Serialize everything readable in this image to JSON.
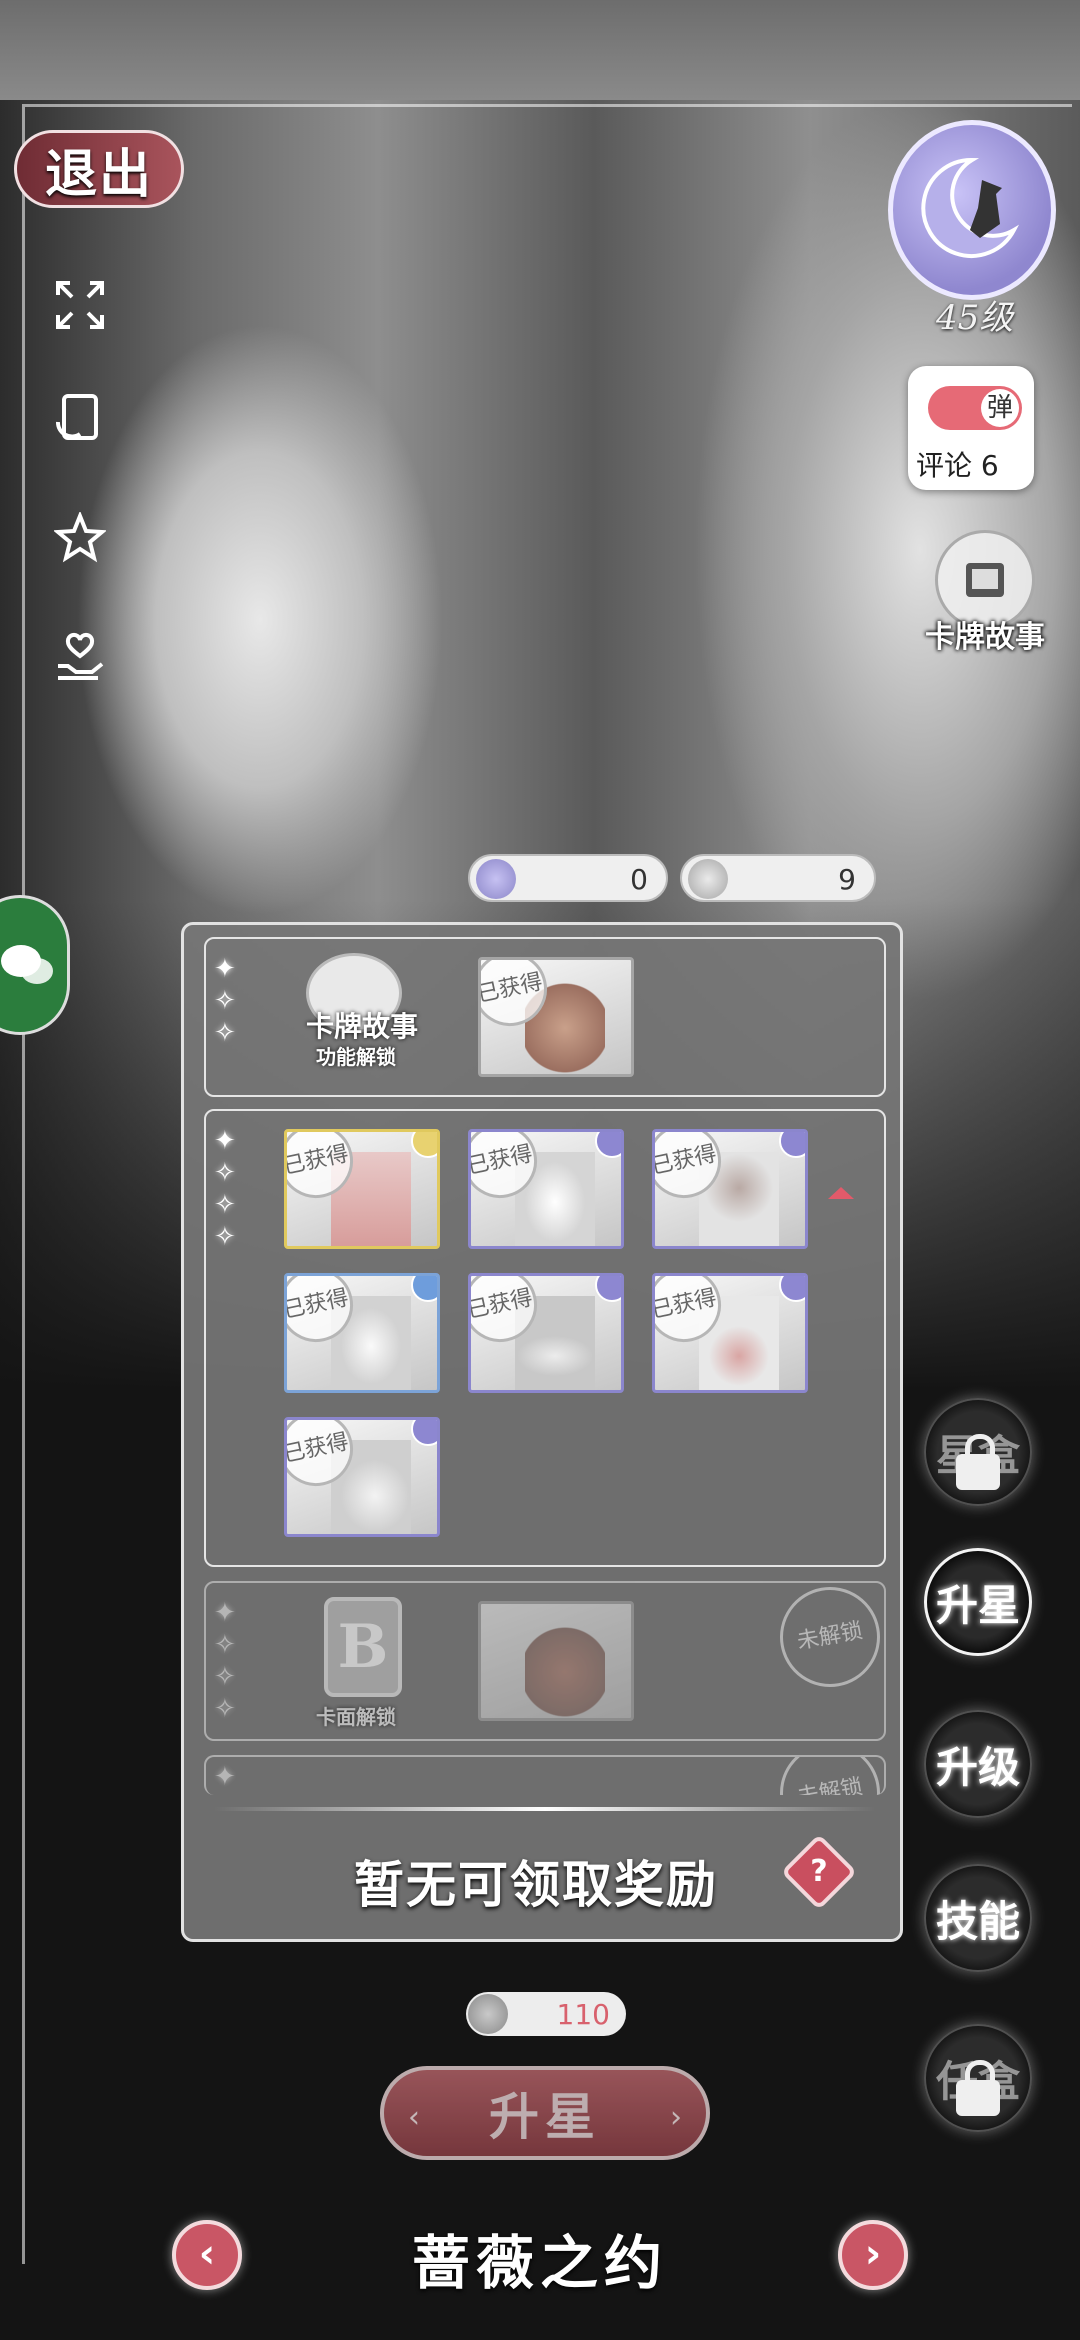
{
  "header": {
    "exit_label": "退出"
  },
  "left_tools": [
    {
      "name": "fullscreen-icon"
    },
    {
      "name": "rotate-card-icon"
    },
    {
      "name": "star-favorite-icon"
    },
    {
      "name": "heart-hand-icon"
    }
  ],
  "right_panel": {
    "level": "45级",
    "danmu_toggle": "弹",
    "comments": "评论 6",
    "card_story": "卡牌故事",
    "buttons": [
      {
        "label": "星盒",
        "locked": true
      },
      {
        "label": "升星",
        "active": true
      },
      {
        "label": "升级"
      },
      {
        "label": "技能"
      },
      {
        "label": "任盒",
        "locked": true
      }
    ]
  },
  "currencies": [
    {
      "icon": "potion-icon",
      "value": "0"
    },
    {
      "icon": "card-fragment-icon",
      "value": "9"
    }
  ],
  "rewards": {
    "sections": [
      {
        "title": "卡牌故事",
        "subtitle": "功能解锁",
        "items": [
          {
            "stamp": "已获得"
          }
        ]
      },
      {
        "items": [
          {
            "stamp": "已获得",
            "rarity": "gold"
          },
          {
            "stamp": "已获得",
            "rarity": "purple"
          },
          {
            "stamp": "已获得",
            "rarity": "purple"
          },
          {
            "stamp": "已获得",
            "rarity": "blue"
          },
          {
            "stamp": "已获得",
            "rarity": "purple"
          },
          {
            "stamp": "已获得",
            "rarity": "purple"
          },
          {
            "stamp": "已获得",
            "rarity": "purple"
          }
        ]
      },
      {
        "badge": "B",
        "subtitle": "卡面解锁",
        "lock_stamp": "未解锁"
      },
      {
        "lock_stamp": "未解锁"
      }
    ],
    "status": "暂无可领取奖励",
    "help_icon": "?"
  },
  "cost": "110",
  "upgrade_button": "升星",
  "card_name": "蔷薇之约",
  "colors": {
    "accent": "#c95665",
    "panel": "#767676",
    "purple": "#8b86cd",
    "gold": "#e0c95e"
  }
}
